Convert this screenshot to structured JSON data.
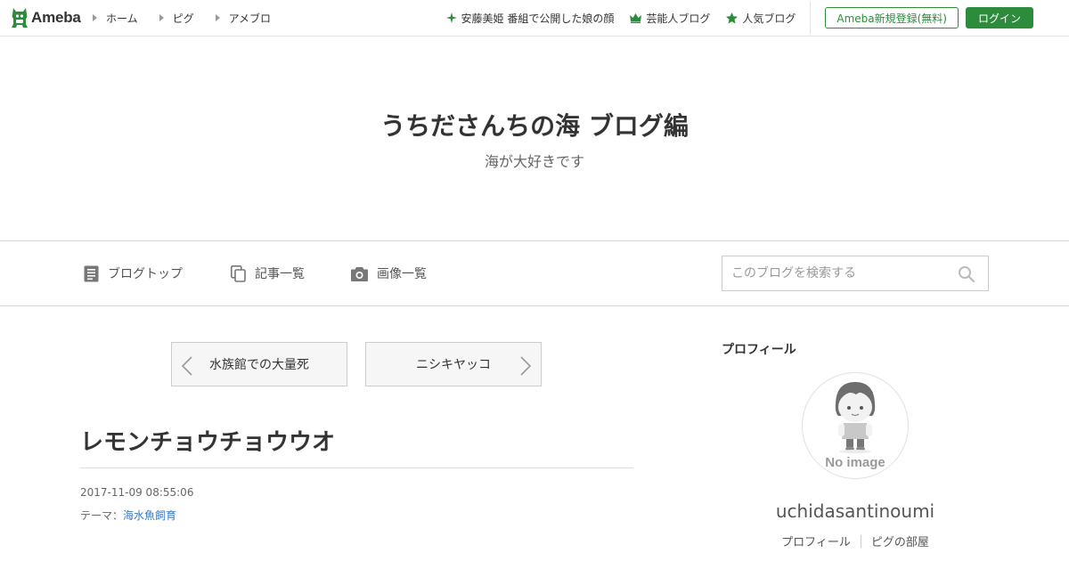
{
  "header": {
    "logo_text": "Ameba",
    "nav": [
      {
        "label": "ホーム"
      },
      {
        "label": "ピグ"
      },
      {
        "label": "アメブロ"
      }
    ],
    "trend_link": "安藤美姫 番組で公開した娘の顔",
    "celebrity_link": "芸能人ブログ",
    "popular_link": "人気ブログ",
    "register_label": "Ameba新規登録(無料)",
    "login_label": "ログイン",
    "accent_color": "#2d8c3c"
  },
  "blog": {
    "title": "うちださんちの海 ブログ編",
    "subtitle": "海が大好きです"
  },
  "blog_nav": {
    "top_label": "ブログトップ",
    "entries_label": "記事一覧",
    "images_label": "画像一覧",
    "search_placeholder": "このブログを検索する"
  },
  "pager": {
    "prev_label": "水族館での大量死",
    "next_label": "ニシキヤッコ"
  },
  "entry": {
    "title": "レモンチョウチョウウオ",
    "date": "2017-11-09 08:55:06",
    "theme_prefix": "テーマ：",
    "theme": "海水魚飼育"
  },
  "sidebar": {
    "heading": "プロフィール",
    "avatar_caption": "No image",
    "username": "uchidasantinoumi",
    "profile_link": "プロフィール",
    "pig_link": "ピグの部屋"
  }
}
